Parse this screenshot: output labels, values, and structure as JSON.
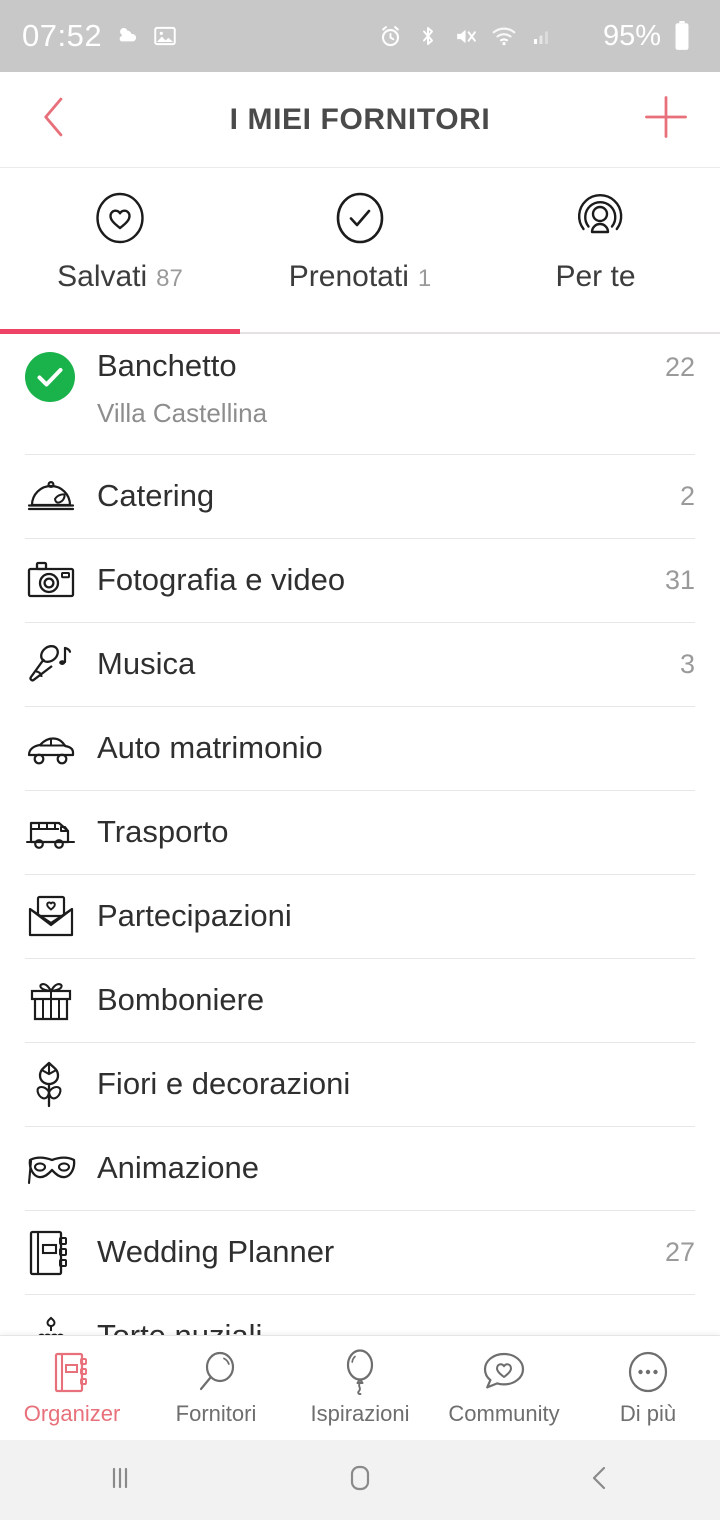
{
  "colors": {
    "accent_pink": "#e8707a",
    "active_pink": "#ee4266",
    "green": "#1ab24b",
    "status_bar_bg": "#c8c8c8",
    "title_gray": "#4a4a4a",
    "count_gray": "#9a9a9a"
  },
  "status_bar": {
    "time": "07:52",
    "left_icons": [
      "weather-sun-cloud-icon",
      "image-icon"
    ],
    "right_icons": [
      "alarm-icon",
      "bluetooth-icon",
      "mute-icon",
      "wifi-icon",
      "signal-icon"
    ],
    "battery_percent": "95%"
  },
  "header": {
    "title": "I MIEI FORNITORI",
    "back_icon": "chevron-left-icon",
    "add_icon": "plus-icon"
  },
  "tabs": [
    {
      "label": "Salvati",
      "count": "87",
      "icon": "heart-circle-icon",
      "active": true
    },
    {
      "label": "Prenotati",
      "count": "1",
      "icon": "check-circle-icon",
      "active": false
    },
    {
      "label": "Per te",
      "count": "",
      "icon": "person-radar-icon",
      "active": false
    }
  ],
  "list": [
    {
      "title": "Banchetto",
      "subtitle": "Villa Castellina",
      "count": "22",
      "icon": "green-check-badge-icon"
    },
    {
      "title": "Catering",
      "subtitle": "",
      "count": "2",
      "icon": "cloche-icon"
    },
    {
      "title": "Fotografia e video",
      "subtitle": "",
      "count": "31",
      "icon": "camera-icon"
    },
    {
      "title": "Musica",
      "subtitle": "",
      "count": "3",
      "icon": "microphone-note-icon"
    },
    {
      "title": "Auto matrimonio",
      "subtitle": "",
      "count": "",
      "icon": "car-icon"
    },
    {
      "title": "Trasporto",
      "subtitle": "",
      "count": "",
      "icon": "bus-icon"
    },
    {
      "title": "Partecipazioni",
      "subtitle": "",
      "count": "",
      "icon": "envelope-heart-icon"
    },
    {
      "title": "Bomboniere",
      "subtitle": "",
      "count": "",
      "icon": "gift-icon"
    },
    {
      "title": "Fiori e decorazioni",
      "subtitle": "",
      "count": "",
      "icon": "tulip-icon"
    },
    {
      "title": "Animazione",
      "subtitle": "",
      "count": "",
      "icon": "mask-icon"
    },
    {
      "title": "Wedding Planner",
      "subtitle": "",
      "count": "27",
      "icon": "notebook-icon"
    },
    {
      "title": "Torte nuziali",
      "subtitle": "",
      "count": "",
      "icon": "wedding-cake-icon"
    }
  ],
  "bottom_nav": [
    {
      "label": "Organizer",
      "icon": "notebook-icon",
      "active": true
    },
    {
      "label": "Fornitori",
      "icon": "magnifier-icon",
      "active": false
    },
    {
      "label": "Ispirazioni",
      "icon": "balloon-icon",
      "active": false
    },
    {
      "label": "Community",
      "icon": "speech-bubble-heart-icon",
      "active": false
    },
    {
      "label": "Di più",
      "icon": "ellipsis-circle-icon",
      "active": false
    }
  ],
  "android_nav": {
    "recents": "recents-icon",
    "home": "home-icon",
    "back": "back-icon"
  }
}
